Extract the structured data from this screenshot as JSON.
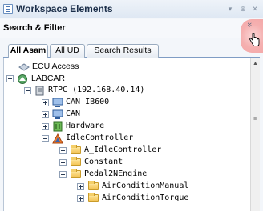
{
  "window": {
    "title": "Workspace Elements",
    "title_buttons": [
      "▾",
      "⊕",
      "✕"
    ]
  },
  "filter_bar": {
    "label": "Search & Filter",
    "expander_glyph": "»"
  },
  "tabs": [
    {
      "label": "All Asam",
      "active": true
    },
    {
      "label": "All UD",
      "active": false
    },
    {
      "label": "Search Results",
      "active": false
    }
  ],
  "tree": [
    {
      "label": "ECU Access",
      "icon": "ecu-access-icon",
      "level": 0,
      "expander": "none"
    },
    {
      "label": "LABCAR",
      "icon": "labcar-icon",
      "level": 0,
      "expander": "minus"
    },
    {
      "label": "RTPC (192.168.40.14)",
      "icon": "rtpc-icon",
      "level": 1,
      "expander": "minus"
    },
    {
      "label": "CAN_IB600",
      "icon": "can-icon",
      "level": 2,
      "expander": "plus"
    },
    {
      "label": "CAN",
      "icon": "can-icon",
      "level": 2,
      "expander": "plus"
    },
    {
      "label": "Hardware",
      "icon": "hardware-icon",
      "level": 2,
      "expander": "plus"
    },
    {
      "label": "IdleController",
      "icon": "controller-icon",
      "level": 2,
      "expander": "minus"
    },
    {
      "label": "A_IdleController",
      "icon": "folder-icon",
      "level": 3,
      "expander": "plus"
    },
    {
      "label": "Constant",
      "icon": "folder-icon",
      "level": 3,
      "expander": "plus"
    },
    {
      "label": "Pedal2NEngine",
      "icon": "folder-icon",
      "level": 3,
      "expander": "minus"
    },
    {
      "label": "AirConditionManual",
      "icon": "folder-icon",
      "level": 4,
      "expander": "plus"
    },
    {
      "label": "AirConditionTorque",
      "icon": "folder-icon",
      "level": 4,
      "expander": "plus"
    }
  ],
  "colors": {
    "accent": "#4b77b5",
    "highlight": "#f5b0b0",
    "folder": "#f2c14e"
  }
}
